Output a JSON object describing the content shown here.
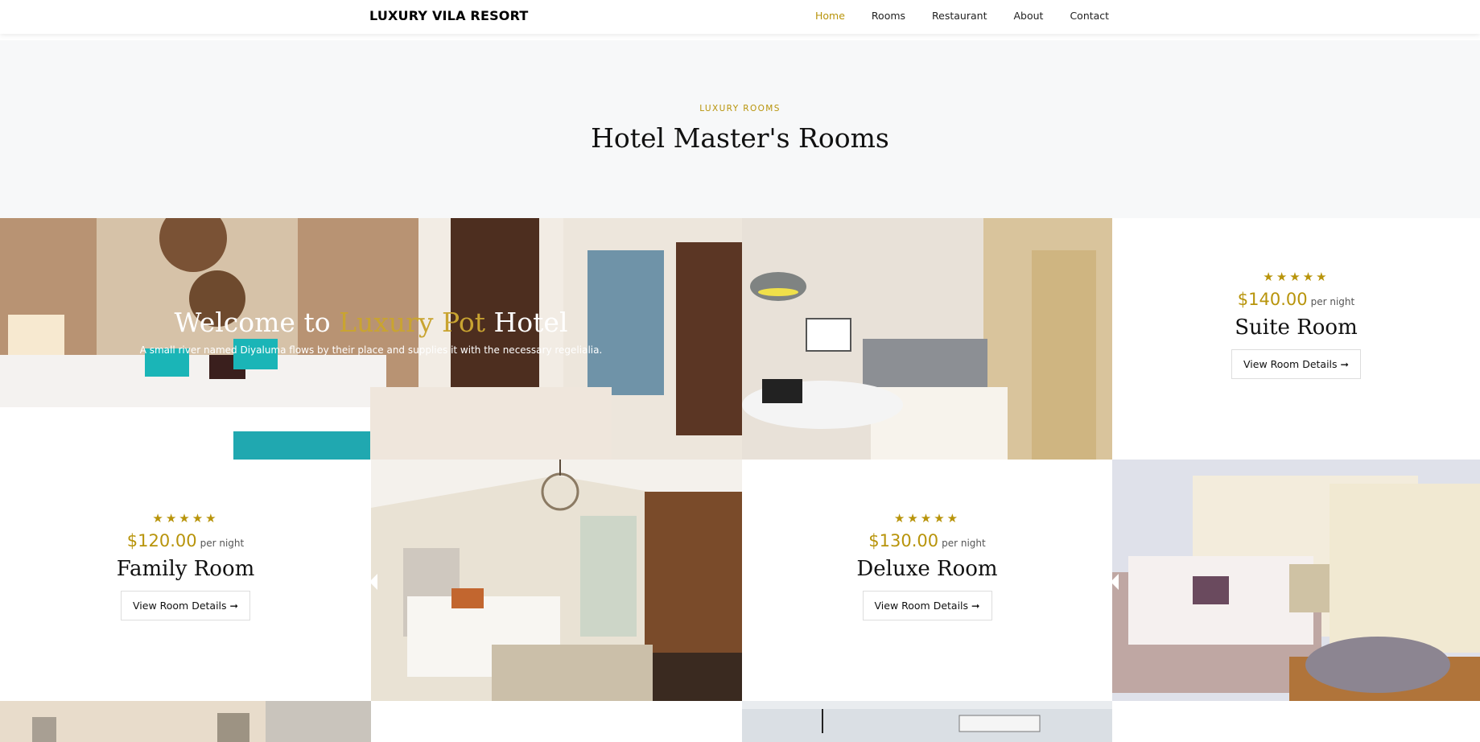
{
  "nav": {
    "brand": "LUXURY VILA RESORT",
    "items": [
      {
        "label": "Home",
        "active": true
      },
      {
        "label": "Rooms"
      },
      {
        "label": "Restaurant"
      },
      {
        "label": "About"
      },
      {
        "label": "Contact"
      }
    ]
  },
  "section": {
    "eyebrow": "LUXURY ROOMS",
    "title": "Hotel Master's Rooms"
  },
  "hero": {
    "heading_pre": "Welcome to ",
    "heading_accent": "Luxury Pot",
    "heading_post": " Hotel",
    "subtitle": "A small river named Diyaluma flows by their place and supplies it with the necessary regelialia."
  },
  "rooms": [
    {
      "stars": "★★★★★",
      "price": "$140.00",
      "per": "per night",
      "name": "Suite Room",
      "button": "View Room Details ➞"
    },
    {
      "stars": "★★★★★",
      "price": "$120.00",
      "per": "per night",
      "name": "Family Room",
      "button": "View Room Details ➞"
    },
    {
      "stars": "★★★★★",
      "price": "$130.00",
      "per": "per night",
      "name": "Deluxe Room",
      "button": "View Room Details ➞"
    }
  ],
  "colors": {
    "accent": "#b8940b",
    "band": "#f7f8f9"
  }
}
